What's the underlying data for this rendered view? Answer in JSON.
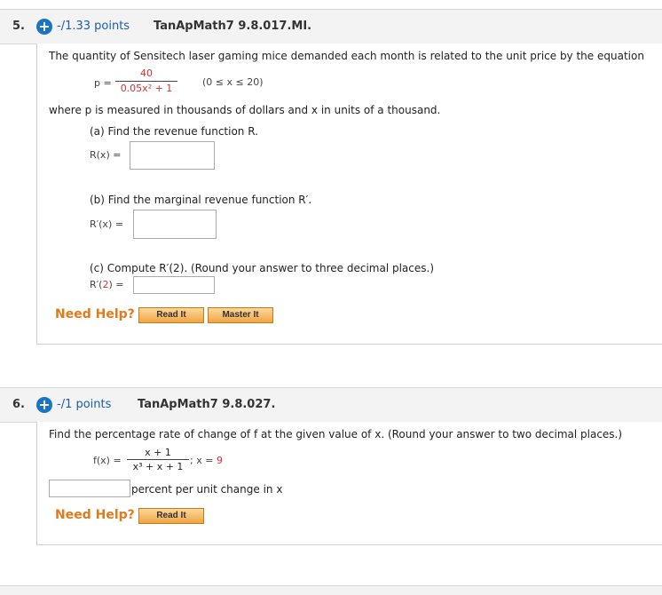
{
  "q5": {
    "number": "5.",
    "plus": "+",
    "points": "-/1.33 points",
    "code": "TanApMath7 9.8.017.MI.",
    "intro": "The quantity of Sensitech laser gaming mice demanded each month is related to the unit price by the equation",
    "eq_lhs": "p =",
    "eq_num": "40",
    "eq_den": "0.05x² + 1",
    "eq_domain": "(0 ≤ x ≤ 20)",
    "where": "where p is measured in thousands of dollars and x in units of a thousand.",
    "part_a": "(a) Find the revenue function R.",
    "label_a": "R(x) =",
    "part_b": "(b) Find the marginal revenue function R′.",
    "label_b": "R′(x) =",
    "part_c": "(c) Compute R′(2). (Round your answer to three decimal places.)",
    "label_c_prefix": "R′(",
    "label_c_arg": "2",
    "label_c_suffix": ") =",
    "need_help": "Need Help?",
    "read_it": "Read It",
    "master_it": "Master It"
  },
  "q6": {
    "number": "6.",
    "plus": "+",
    "points": "-/1 points",
    "code": "TanApMath7 9.8.027.",
    "intro": "Find the percentage rate of change of f at the given value of x. (Round your answer to two decimal places.)",
    "fx_lhs": "f(x) =",
    "fx_num": "x + 1",
    "fx_den": "x³ + x + 1",
    "fx_at_prefix": "; x = ",
    "fx_at_value": "9",
    "answer_suffix": "percent per unit change in x",
    "need_help": "Need Help?",
    "read_it": "Read It"
  }
}
